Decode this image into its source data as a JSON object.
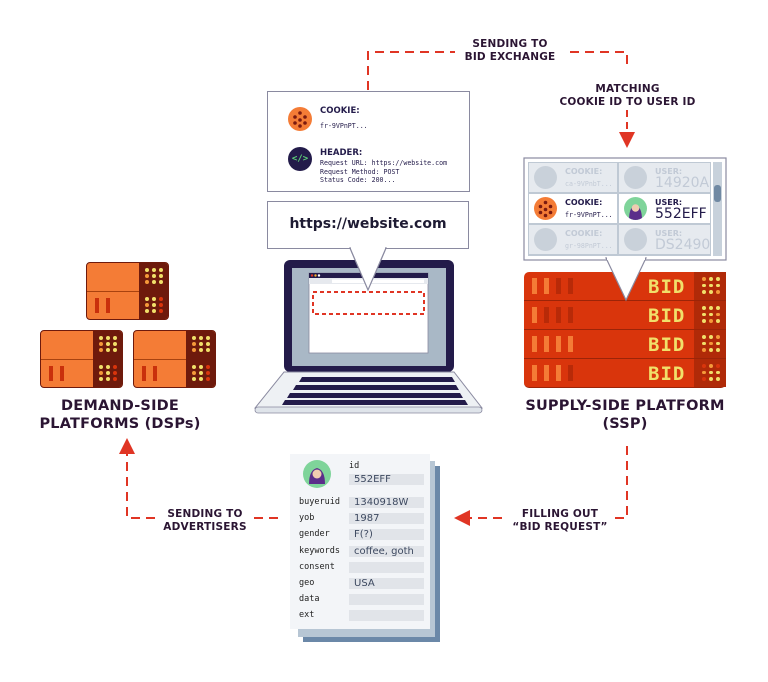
{
  "colors": {
    "arrow": "#e03524",
    "text_dark": "#2b1533",
    "ssp_red": "#d9350c",
    "dsp_orange": "#f47c36",
    "dsp_dark": "#6e1a0c",
    "laptop_navy": "#231b4a",
    "bid_yellow": "#f1e06a"
  },
  "labels": {
    "sending_to_bid_exchange": [
      "SENDING TO",
      "BID EXCHANGE"
    ],
    "matching_cookie": [
      "MATCHING",
      "COOKIE ID TO USER ID"
    ],
    "sending_to_advertisers": [
      "SENDING TO",
      "ADVERTISERS"
    ],
    "filling_out_bid_request": [
      "FILLING OUT",
      "“BID REQUEST”"
    ]
  },
  "dsp": {
    "title": [
      "DEMAND-SIDE",
      "PLATFORMS (DSPs)"
    ],
    "server_count": 3
  },
  "ssp": {
    "title": [
      "SUPPLY-SIDE PLATFORM",
      "(SSP)"
    ],
    "rack_label": "BID",
    "rack_count": 4,
    "match_table": [
      {
        "cookie_label": "COOKIE:",
        "cookie_value": "ca-9VPnbT...",
        "user_label": "USER:",
        "user_value": "14920A",
        "active": false
      },
      {
        "cookie_label": "COOKIE:",
        "cookie_value": "fr-9VPnPT...",
        "user_label": "USER:",
        "user_value": "552EFF",
        "active": true
      },
      {
        "cookie_label": "COOKIE:",
        "cookie_value": "gr-98PnPT...",
        "user_label": "USER:",
        "user_value": "DS2490",
        "active": false
      }
    ]
  },
  "request_info": {
    "cookie_title": "COOKIE:",
    "cookie_value": "fr-9VPnPT...",
    "header_title": "HEADER:",
    "header_lines": "Request URL: https://website.com\nRequest Method: POST\nStatus Code: 200...",
    "header_icon": "</>"
  },
  "browser": {
    "url": "https://website.com"
  },
  "bid_request": {
    "id_label": "id",
    "id_value": "552EFF",
    "fields": [
      {
        "key": "buyeruid",
        "value": "1340918W"
      },
      {
        "key": "yob",
        "value": "1987"
      },
      {
        "key": "gender",
        "value": "F(?)"
      },
      {
        "key": "keywords",
        "value": "coffee, goth"
      },
      {
        "key": "consent",
        "value": ""
      },
      {
        "key": "geo",
        "value": "USA"
      },
      {
        "key": "data",
        "value": ""
      },
      {
        "key": "ext",
        "value": ""
      }
    ]
  }
}
